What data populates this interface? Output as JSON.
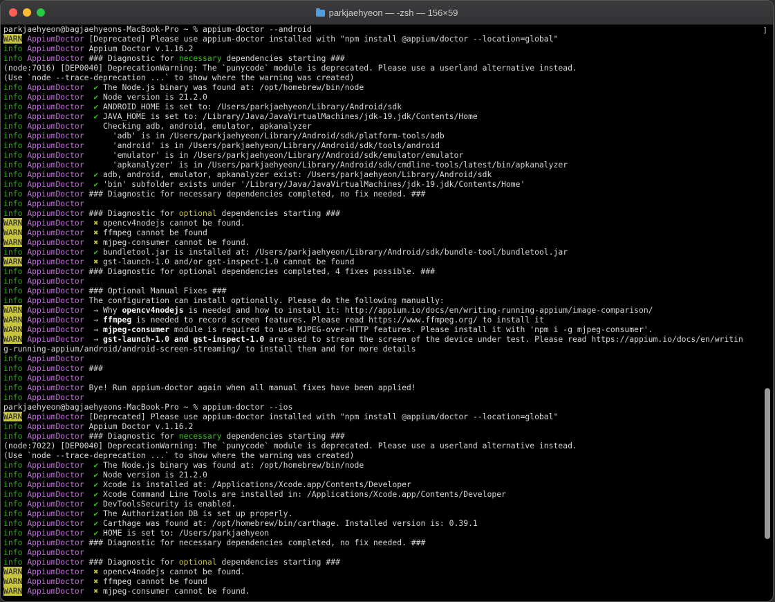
{
  "window": {
    "title": "parkjaehyeon — -zsh — 156×59"
  },
  "scroll_marker": "]",
  "lines": [
    [
      {
        "t": "parkjaehyeon@bagjaehyeons-MacBook-Pro ~ % appium-doctor --android"
      }
    ],
    [
      {
        "t": "WARN",
        "c": "lvl-warn"
      },
      {
        "t": " "
      },
      {
        "t": "AppiumDoctor",
        "c": "tag"
      },
      {
        "t": " [Deprecated] Please use appium-doctor installed with \"npm install @appium/doctor --location=global\""
      }
    ],
    [
      {
        "t": "info",
        "c": "lvl-info"
      },
      {
        "t": " "
      },
      {
        "t": "AppiumDoctor",
        "c": "tag"
      },
      {
        "t": " Appium Doctor v.1.16.2"
      }
    ],
    [
      {
        "t": "info",
        "c": "lvl-info"
      },
      {
        "t": " "
      },
      {
        "t": "AppiumDoctor",
        "c": "tag"
      },
      {
        "t": " ### Diagnostic for "
      },
      {
        "t": "necessary",
        "c": "g"
      },
      {
        "t": " dependencies starting ###"
      }
    ],
    [
      {
        "t": "(node:7016) [DEP0040] DeprecationWarning: The `punycode` module is deprecated. Please use a userland alternative instead."
      }
    ],
    [
      {
        "t": "(Use `node --trace-deprecation ...` to show where the warning was created)"
      }
    ],
    [
      {
        "t": "info",
        "c": "lvl-info"
      },
      {
        "t": " "
      },
      {
        "t": "AppiumDoctor",
        "c": "tag"
      },
      {
        "t": "  "
      },
      {
        "t": "✔",
        "c": "ok"
      },
      {
        "t": " The Node.js binary was found at: /opt/homebrew/bin/node"
      }
    ],
    [
      {
        "t": "info",
        "c": "lvl-info"
      },
      {
        "t": " "
      },
      {
        "t": "AppiumDoctor",
        "c": "tag"
      },
      {
        "t": "  "
      },
      {
        "t": "✔",
        "c": "ok"
      },
      {
        "t": " Node version is 21.2.0"
      }
    ],
    [
      {
        "t": "info",
        "c": "lvl-info"
      },
      {
        "t": " "
      },
      {
        "t": "AppiumDoctor",
        "c": "tag"
      },
      {
        "t": "  "
      },
      {
        "t": "✔",
        "c": "ok"
      },
      {
        "t": " ANDROID_HOME is set to: /Users/parkjaehyeon/Library/Android/sdk"
      }
    ],
    [
      {
        "t": "info",
        "c": "lvl-info"
      },
      {
        "t": " "
      },
      {
        "t": "AppiumDoctor",
        "c": "tag"
      },
      {
        "t": "  "
      },
      {
        "t": "✔",
        "c": "ok"
      },
      {
        "t": " JAVA_HOME is set to: /Library/Java/JavaVirtualMachines/jdk-19.jdk/Contents/Home"
      }
    ],
    [
      {
        "t": "info",
        "c": "lvl-info"
      },
      {
        "t": " "
      },
      {
        "t": "AppiumDoctor",
        "c": "tag"
      },
      {
        "t": "    Checking adb, android, emulator, apkanalyzer"
      }
    ],
    [
      {
        "t": "info",
        "c": "lvl-info"
      },
      {
        "t": " "
      },
      {
        "t": "AppiumDoctor",
        "c": "tag"
      },
      {
        "t": "      'adb' is in /Users/parkjaehyeon/Library/Android/sdk/platform-tools/adb"
      }
    ],
    [
      {
        "t": "info",
        "c": "lvl-info"
      },
      {
        "t": " "
      },
      {
        "t": "AppiumDoctor",
        "c": "tag"
      },
      {
        "t": "      'android' is in /Users/parkjaehyeon/Library/Android/sdk/tools/android"
      }
    ],
    [
      {
        "t": "info",
        "c": "lvl-info"
      },
      {
        "t": " "
      },
      {
        "t": "AppiumDoctor",
        "c": "tag"
      },
      {
        "t": "      'emulator' is in /Users/parkjaehyeon/Library/Android/sdk/emulator/emulator"
      }
    ],
    [
      {
        "t": "info",
        "c": "lvl-info"
      },
      {
        "t": " "
      },
      {
        "t": "AppiumDoctor",
        "c": "tag"
      },
      {
        "t": "      'apkanalyzer' is in /Users/parkjaehyeon/Library/Android/sdk/cmdline-tools/latest/bin/apkanalyzer"
      }
    ],
    [
      {
        "t": "info",
        "c": "lvl-info"
      },
      {
        "t": " "
      },
      {
        "t": "AppiumDoctor",
        "c": "tag"
      },
      {
        "t": "  "
      },
      {
        "t": "✔",
        "c": "ok"
      },
      {
        "t": " adb, android, emulator, apkanalyzer exist: /Users/parkjaehyeon/Library/Android/sdk"
      }
    ],
    [
      {
        "t": "info",
        "c": "lvl-info"
      },
      {
        "t": " "
      },
      {
        "t": "AppiumDoctor",
        "c": "tag"
      },
      {
        "t": "  "
      },
      {
        "t": "✔",
        "c": "ok"
      },
      {
        "t": " 'bin' subfolder exists under '/Library/Java/JavaVirtualMachines/jdk-19.jdk/Contents/Home'"
      }
    ],
    [
      {
        "t": "info",
        "c": "lvl-info"
      },
      {
        "t": " "
      },
      {
        "t": "AppiumDoctor",
        "c": "tag"
      },
      {
        "t": " ### Diagnostic for necessary dependencies completed, no fix needed. ###"
      }
    ],
    [
      {
        "t": "info",
        "c": "lvl-info"
      },
      {
        "t": " "
      },
      {
        "t": "AppiumDoctor",
        "c": "tag"
      }
    ],
    [
      {
        "t": "info",
        "c": "lvl-info"
      },
      {
        "t": " "
      },
      {
        "t": "AppiumDoctor",
        "c": "tag"
      },
      {
        "t": " ### Diagnostic for "
      },
      {
        "t": "optional",
        "c": "x"
      },
      {
        "t": " dependencies starting ###"
      }
    ],
    [
      {
        "t": "WARN",
        "c": "lvl-warn"
      },
      {
        "t": " "
      },
      {
        "t": "AppiumDoctor",
        "c": "tag"
      },
      {
        "t": "  "
      },
      {
        "t": "✖",
        "c": "x"
      },
      {
        "t": " opencv4nodejs cannot be found."
      }
    ],
    [
      {
        "t": "WARN",
        "c": "lvl-warn"
      },
      {
        "t": " "
      },
      {
        "t": "AppiumDoctor",
        "c": "tag"
      },
      {
        "t": "  "
      },
      {
        "t": "✖",
        "c": "x"
      },
      {
        "t": " ffmpeg cannot be found"
      }
    ],
    [
      {
        "t": "WARN",
        "c": "lvl-warn"
      },
      {
        "t": " "
      },
      {
        "t": "AppiumDoctor",
        "c": "tag"
      },
      {
        "t": "  "
      },
      {
        "t": "✖",
        "c": "x"
      },
      {
        "t": " mjpeg-consumer cannot be found."
      }
    ],
    [
      {
        "t": "info",
        "c": "lvl-info"
      },
      {
        "t": " "
      },
      {
        "t": "AppiumDoctor",
        "c": "tag"
      },
      {
        "t": "  "
      },
      {
        "t": "✔",
        "c": "ok"
      },
      {
        "t": " bundletool.jar is installed at: /Users/parkjaehyeon/Library/Android/sdk/bundle-tool/bundletool.jar"
      }
    ],
    [
      {
        "t": "WARN",
        "c": "lvl-warn"
      },
      {
        "t": " "
      },
      {
        "t": "AppiumDoctor",
        "c": "tag"
      },
      {
        "t": "  "
      },
      {
        "t": "✖",
        "c": "x"
      },
      {
        "t": " gst-launch-1.0 and/or gst-inspect-1.0 cannot be found"
      }
    ],
    [
      {
        "t": "info",
        "c": "lvl-info"
      },
      {
        "t": " "
      },
      {
        "t": "AppiumDoctor",
        "c": "tag"
      },
      {
        "t": " ### Diagnostic for optional dependencies completed, 4 fixes possible. ###"
      }
    ],
    [
      {
        "t": "info",
        "c": "lvl-info"
      },
      {
        "t": " "
      },
      {
        "t": "AppiumDoctor",
        "c": "tag"
      }
    ],
    [
      {
        "t": "info",
        "c": "lvl-info"
      },
      {
        "t": " "
      },
      {
        "t": "AppiumDoctor",
        "c": "tag"
      },
      {
        "t": " ### Optional Manual Fixes ###"
      }
    ],
    [
      {
        "t": "info",
        "c": "lvl-info"
      },
      {
        "t": " "
      },
      {
        "t": "AppiumDoctor",
        "c": "tag"
      },
      {
        "t": " The configuration can install optionally. Please do the following manually:"
      }
    ],
    [
      {
        "t": "WARN",
        "c": "lvl-warn"
      },
      {
        "t": " "
      },
      {
        "t": "AppiumDoctor",
        "c": "tag"
      },
      {
        "t": "  → Why "
      },
      {
        "t": "opencv4nodejs",
        "c": "b"
      },
      {
        "t": " is needed and how to install it: http://appium.io/docs/en/writing-running-appium/image-comparison/"
      }
    ],
    [
      {
        "t": "WARN",
        "c": "lvl-warn"
      },
      {
        "t": " "
      },
      {
        "t": "AppiumDoctor",
        "c": "tag"
      },
      {
        "t": "  → "
      },
      {
        "t": "ffmpeg",
        "c": "b"
      },
      {
        "t": " is needed to record screen features. Please read https://www.ffmpeg.org/ to install it"
      }
    ],
    [
      {
        "t": "WARN",
        "c": "lvl-warn"
      },
      {
        "t": " "
      },
      {
        "t": "AppiumDoctor",
        "c": "tag"
      },
      {
        "t": "  → "
      },
      {
        "t": "mjpeg-consumer",
        "c": "b"
      },
      {
        "t": " module is required to use MJPEG-over-HTTP features. Please install it with 'npm i -g mjpeg-consumer'."
      }
    ],
    [
      {
        "t": "WARN",
        "c": "lvl-warn"
      },
      {
        "t": " "
      },
      {
        "t": "AppiumDoctor",
        "c": "tag"
      },
      {
        "t": "  → "
      },
      {
        "t": "gst-launch-1.0 and gst-inspect-1.0",
        "c": "b"
      },
      {
        "t": " are used to stream the screen of the device under test. Please read https://appium.io/docs/en/writin"
      }
    ],
    [
      {
        "t": "g-running-appium/android/android-screen-streaming/ to install them and for more details"
      }
    ],
    [
      {
        "t": "info",
        "c": "lvl-info"
      },
      {
        "t": " "
      },
      {
        "t": "AppiumDoctor",
        "c": "tag"
      }
    ],
    [
      {
        "t": "info",
        "c": "lvl-info"
      },
      {
        "t": " "
      },
      {
        "t": "AppiumDoctor",
        "c": "tag"
      },
      {
        "t": " ###"
      }
    ],
    [
      {
        "t": "info",
        "c": "lvl-info"
      },
      {
        "t": " "
      },
      {
        "t": "AppiumDoctor",
        "c": "tag"
      }
    ],
    [
      {
        "t": "info",
        "c": "lvl-info"
      },
      {
        "t": " "
      },
      {
        "t": "AppiumDoctor",
        "c": "tag"
      },
      {
        "t": " Bye! Run appium-doctor again when all manual fixes have been applied!"
      }
    ],
    [
      {
        "t": "info",
        "c": "lvl-info"
      },
      {
        "t": " "
      },
      {
        "t": "AppiumDoctor",
        "c": "tag"
      }
    ],
    [
      {
        "t": "parkjaehyeon@bagjaehyeons-MacBook-Pro ~ % appium-doctor --ios"
      }
    ],
    [
      {
        "t": "WARN",
        "c": "lvl-warn"
      },
      {
        "t": " "
      },
      {
        "t": "AppiumDoctor",
        "c": "tag"
      },
      {
        "t": " [Deprecated] Please use appium-doctor installed with \"npm install @appium/doctor --location=global\""
      }
    ],
    [
      {
        "t": "info",
        "c": "lvl-info"
      },
      {
        "t": " "
      },
      {
        "t": "AppiumDoctor",
        "c": "tag"
      },
      {
        "t": " Appium Doctor v.1.16.2"
      }
    ],
    [
      {
        "t": "info",
        "c": "lvl-info"
      },
      {
        "t": " "
      },
      {
        "t": "AppiumDoctor",
        "c": "tag"
      },
      {
        "t": " ### Diagnostic for "
      },
      {
        "t": "necessary",
        "c": "g"
      },
      {
        "t": " dependencies starting ###"
      }
    ],
    [
      {
        "t": "(node:7022) [DEP0040] DeprecationWarning: The `punycode` module is deprecated. Please use a userland alternative instead."
      }
    ],
    [
      {
        "t": "(Use `node --trace-deprecation ...` to show where the warning was created)"
      }
    ],
    [
      {
        "t": "info",
        "c": "lvl-info"
      },
      {
        "t": " "
      },
      {
        "t": "AppiumDoctor",
        "c": "tag"
      },
      {
        "t": "  "
      },
      {
        "t": "✔",
        "c": "ok"
      },
      {
        "t": " The Node.js binary was found at: /opt/homebrew/bin/node"
      }
    ],
    [
      {
        "t": "info",
        "c": "lvl-info"
      },
      {
        "t": " "
      },
      {
        "t": "AppiumDoctor",
        "c": "tag"
      },
      {
        "t": "  "
      },
      {
        "t": "✔",
        "c": "ok"
      },
      {
        "t": " Node version is 21.2.0"
      }
    ],
    [
      {
        "t": "info",
        "c": "lvl-info"
      },
      {
        "t": " "
      },
      {
        "t": "AppiumDoctor",
        "c": "tag"
      },
      {
        "t": "  "
      },
      {
        "t": "✔",
        "c": "ok"
      },
      {
        "t": " Xcode is installed at: /Applications/Xcode.app/Contents/Developer"
      }
    ],
    [
      {
        "t": "info",
        "c": "lvl-info"
      },
      {
        "t": " "
      },
      {
        "t": "AppiumDoctor",
        "c": "tag"
      },
      {
        "t": "  "
      },
      {
        "t": "✔",
        "c": "ok"
      },
      {
        "t": " Xcode Command Line Tools are installed in: /Applications/Xcode.app/Contents/Developer"
      }
    ],
    [
      {
        "t": "info",
        "c": "lvl-info"
      },
      {
        "t": " "
      },
      {
        "t": "AppiumDoctor",
        "c": "tag"
      },
      {
        "t": "  "
      },
      {
        "t": "✔",
        "c": "ok"
      },
      {
        "t": " DevToolsSecurity is enabled."
      }
    ],
    [
      {
        "t": "info",
        "c": "lvl-info"
      },
      {
        "t": " "
      },
      {
        "t": "AppiumDoctor",
        "c": "tag"
      },
      {
        "t": "  "
      },
      {
        "t": "✔",
        "c": "ok"
      },
      {
        "t": " The Authorization DB is set up properly."
      }
    ],
    [
      {
        "t": "info",
        "c": "lvl-info"
      },
      {
        "t": " "
      },
      {
        "t": "AppiumDoctor",
        "c": "tag"
      },
      {
        "t": "  "
      },
      {
        "t": "✔",
        "c": "ok"
      },
      {
        "t": " Carthage was found at: /opt/homebrew/bin/carthage. Installed version is: 0.39.1"
      }
    ],
    [
      {
        "t": "info",
        "c": "lvl-info"
      },
      {
        "t": " "
      },
      {
        "t": "AppiumDoctor",
        "c": "tag"
      },
      {
        "t": "  "
      },
      {
        "t": "✔",
        "c": "ok"
      },
      {
        "t": " HOME is set to: /Users/parkjaehyeon"
      }
    ],
    [
      {
        "t": "info",
        "c": "lvl-info"
      },
      {
        "t": " "
      },
      {
        "t": "AppiumDoctor",
        "c": "tag"
      },
      {
        "t": " ### Diagnostic for necessary dependencies completed, no fix needed. ###"
      }
    ],
    [
      {
        "t": "info",
        "c": "lvl-info"
      },
      {
        "t": " "
      },
      {
        "t": "AppiumDoctor",
        "c": "tag"
      }
    ],
    [
      {
        "t": "info",
        "c": "lvl-info"
      },
      {
        "t": " "
      },
      {
        "t": "AppiumDoctor",
        "c": "tag"
      },
      {
        "t": " ### Diagnostic for "
      },
      {
        "t": "optional",
        "c": "x"
      },
      {
        "t": " dependencies starting ###"
      }
    ],
    [
      {
        "t": "WARN",
        "c": "lvl-warn"
      },
      {
        "t": " "
      },
      {
        "t": "AppiumDoctor",
        "c": "tag"
      },
      {
        "t": "  "
      },
      {
        "t": "✖",
        "c": "x"
      },
      {
        "t": " opencv4nodejs cannot be found."
      }
    ],
    [
      {
        "t": "WARN",
        "c": "lvl-warn"
      },
      {
        "t": " "
      },
      {
        "t": "AppiumDoctor",
        "c": "tag"
      },
      {
        "t": "  "
      },
      {
        "t": "✖",
        "c": "x"
      },
      {
        "t": " ffmpeg cannot be found"
      }
    ],
    [
      {
        "t": "WARN",
        "c": "lvl-warn"
      },
      {
        "t": " "
      },
      {
        "t": "AppiumDoctor",
        "c": "tag"
      },
      {
        "t": "  "
      },
      {
        "t": "✖",
        "c": "x"
      },
      {
        "t": " mjpeg-consumer cannot be found."
      }
    ]
  ]
}
